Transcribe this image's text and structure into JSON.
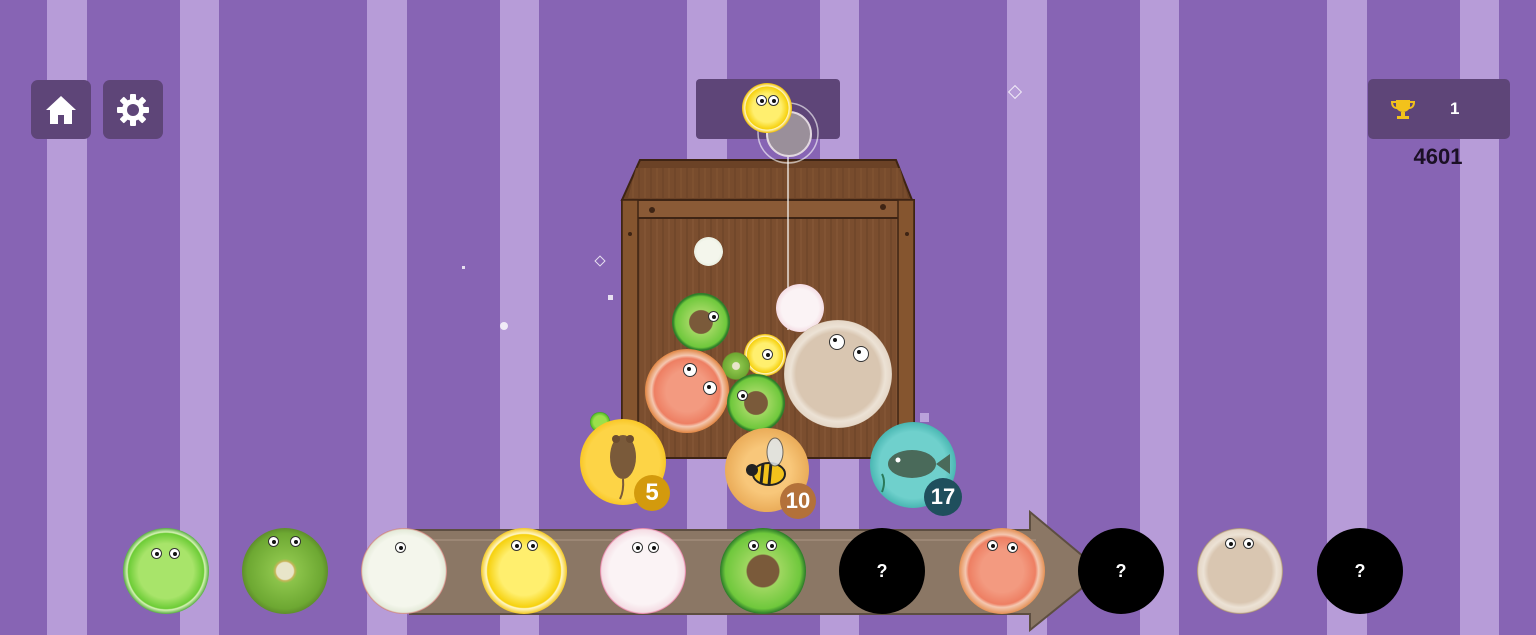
{
  "hud": {
    "home_icon": "home-icon",
    "settings_icon": "gear-icon",
    "trophy_icon": "trophy-icon",
    "trophy_count": "1",
    "score": "4601"
  },
  "preview": {
    "current_fruit": "lemon",
    "queued_fruit": "dragonfruit"
  },
  "badges": {
    "mouse": "5",
    "bee": "10",
    "fish": "17"
  },
  "evolution": {
    "unknown_label": "?",
    "items": [
      {
        "name": "lime",
        "known": true
      },
      {
        "name": "kiwi",
        "known": true
      },
      {
        "name": "apple",
        "known": true
      },
      {
        "name": "lemon",
        "known": true
      },
      {
        "name": "dragonfruit",
        "known": true
      },
      {
        "name": "avocado",
        "known": true
      },
      {
        "name": "unknown",
        "known": false
      },
      {
        "name": "grapefruit",
        "known": true
      },
      {
        "name": "unknown",
        "known": false
      },
      {
        "name": "coconut",
        "known": true
      },
      {
        "name": "unknown",
        "known": false
      }
    ]
  },
  "colors": {
    "background_purple": "#8764b4",
    "background_stripe": "#b79cd8",
    "panel": "#5e4578",
    "crate_wood": "#7a4f30"
  }
}
